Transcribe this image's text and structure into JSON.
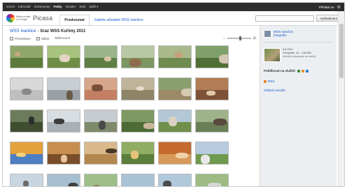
{
  "gbar": {
    "links": [
      "Gmail",
      "Kalendář",
      "Dokumenty",
      "Fotky",
      "Reader",
      "Web",
      "další ▾"
    ],
    "active_index": 3,
    "login": "Přihlásit se"
  },
  "header": {
    "logo_small": "Webová alba od Google",
    "logo_brand": "Picasa",
    "tabs": [
      "Prozkoumat",
      "Galerie uživatele WSS Ivančice"
    ],
    "active_tab": 0,
    "search_placeholder": "",
    "search_button": "Vyhledávání"
  },
  "main": {
    "crumb_owner": "WSS Ivančice",
    "crumb_sep": "›",
    "crumb_title": "Sraz WSS Kuřimy 2011",
    "toolbar": [
      "Prezentace",
      "Sdílet",
      "Stáhnout ▾"
    ],
    "zoom_minus": "−",
    "zoom_plus": "⊞",
    "zoom_level": 0.55
  },
  "photos": [
    {
      "bg": "#8fa86a",
      "sub": "#5c7a3a",
      "b1": "#c9a77d"
    },
    {
      "bg": "#a8c27f",
      "sub": "#6e8e46",
      "b1": "#e2d6c2"
    },
    {
      "bg": "#9bb58a",
      "sub": "#5e7f43",
      "b1": "#d9c4a8"
    },
    {
      "bg": "#b8c7a4",
      "sub": "#7b9660",
      "b1": "#8e6b4a"
    },
    {
      "bg": "#a9b98c",
      "sub": "#6f8b4f",
      "b1": "#c7a07a"
    },
    {
      "bg": "#7fa06a",
      "sub": "#4f7034",
      "b1": "#d3c6b3"
    },
    {
      "bg": "#d8d8d8",
      "sub": "#bfbfbf",
      "b1": "#8a8a8a"
    },
    {
      "bg": "#c9ced3",
      "sub": "#9aa0a6",
      "b1": "#6b5a48"
    },
    {
      "bg": "#d7a58c",
      "sub": "#c27f62",
      "b1": "#7a4f3a"
    },
    {
      "bg": "#bfb49a",
      "sub": "#8e8466",
      "b1": "#e6dccb"
    },
    {
      "bg": "#8aa06e",
      "sub": "#9c8a66",
      "b1": "#d6c9b2"
    },
    {
      "bg": "#b27d55",
      "sub": "#7d5236",
      "b1": "#e0c9a6"
    },
    {
      "bg": "#6c7c5a",
      "sub": "#3f4d31",
      "b1": "#2e2e2e"
    },
    {
      "bg": "#d8dde2",
      "sub": "#a8b0b8",
      "b1": "#3c3c3c"
    },
    {
      "bg": "#c7ccd1",
      "sub": "#7f8a6a",
      "b1": "#4a4a4a"
    },
    {
      "bg": "#7e9a62",
      "sub": "#4d6b35",
      "b1": "#c9b79a"
    },
    {
      "bg": "#b2c8d6",
      "sub": "#6f8f4b",
      "b1": "#d9d2c4"
    },
    {
      "bg": "#9fb38a",
      "sub": "#6b7f56",
      "b1": "#5a4a3c"
    },
    {
      "bg": "#e4a13c",
      "sub": "#4c7ec4",
      "b1": "#f2d27a"
    },
    {
      "bg": "#c78f4f",
      "sub": "#7a4e2a",
      "b1": "#e9c59a"
    },
    {
      "bg": "#d9b98a",
      "sub": "#b3874e",
      "b1": "#4a3826"
    },
    {
      "bg": "#8fae63",
      "sub": "#5b7e3a",
      "b1": "#e8c37a"
    },
    {
      "bg": "#c46a2e",
      "sub": "#d89a5a",
      "b1": "#f0d2a8"
    },
    {
      "bg": "#b6cbe0",
      "sub": "#6f9a4d",
      "b1": "#e8e8e8"
    },
    {
      "bg": "#c8d6e0",
      "sub": "#7f9f63",
      "b1": "#6a6a6a"
    },
    {
      "bg": "#a6bfd0",
      "sub": "#6f8f55",
      "b1": "#3f3f3f"
    },
    {
      "bg": "#9fbf8a",
      "sub": "#5f8446",
      "b1": "#8f7a5c"
    },
    {
      "bg": "#a9c3d6",
      "sub": "#67904a",
      "b1": "#cfcfcf"
    },
    {
      "bg": "#b0c8dc",
      "sub": "#6c9151",
      "b1": "#4b4b4b"
    },
    {
      "bg": "#9dbb83",
      "sub": "#5a7f3f",
      "b1": "#d6d6d6"
    }
  ],
  "sidebar": {
    "owner_name": "WSS Ivančice",
    "owner_sub": "fotografie",
    "album_date": "8.8.2011",
    "album_count": "Fotografie: 30 – 106 MB",
    "album_visibility": "Veřejné (dostupné na webu)",
    "share_label": "Publikovat na službě:",
    "share_colors": [
      "#3b8d3b",
      "#e98a2b",
      "#2d7fd3"
    ],
    "rss": "RSS",
    "report": "Ohlásit zneužití"
  }
}
